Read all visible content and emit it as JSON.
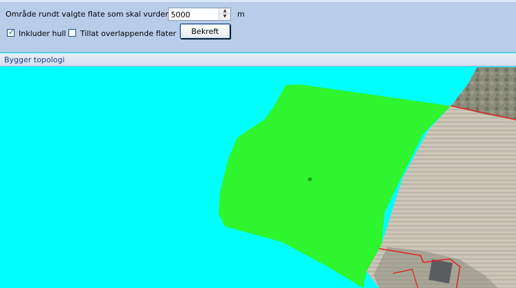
{
  "form": {
    "area_label": "Område rundt valgte flate som skal vurderes:",
    "area_value": "5000",
    "area_unit": "m",
    "include_holes_label": "Inkluder hull",
    "include_holes_checked": true,
    "allow_overlap_label": "Tillat overlappende flater",
    "allow_overlap_checked": false,
    "confirm_label": "Bekreft"
  },
  "status": {
    "text": "Bygger topologi"
  },
  "colors": {
    "panel": "#b9cde9",
    "background": "#00ffff",
    "selected_polygon": "#2ef52e",
    "boundary": "#e02020"
  },
  "icons": {
    "spin_up": "arrow-up-icon",
    "spin_down": "arrow-down-icon",
    "checkmark": "checkmark-icon"
  }
}
